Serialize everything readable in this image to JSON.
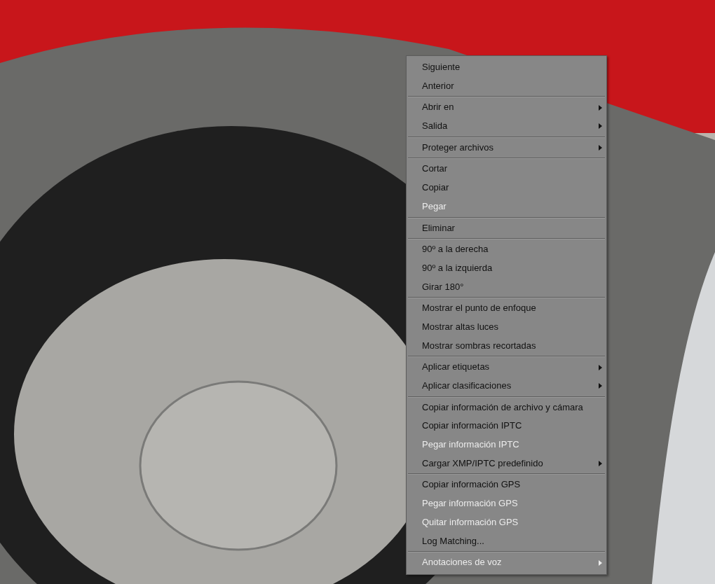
{
  "context_menu": {
    "items": [
      {
        "kind": "item",
        "label": "Siguiente",
        "disabled": false,
        "submenu": false
      },
      {
        "kind": "item",
        "label": "Anterior",
        "disabled": false,
        "submenu": false
      },
      {
        "kind": "separator"
      },
      {
        "kind": "item",
        "label": "Abrir en",
        "disabled": false,
        "submenu": true
      },
      {
        "kind": "item",
        "label": "Salida",
        "disabled": false,
        "submenu": true
      },
      {
        "kind": "separator"
      },
      {
        "kind": "item",
        "label": "Proteger archivos",
        "disabled": false,
        "submenu": true
      },
      {
        "kind": "separator"
      },
      {
        "kind": "item",
        "label": "Cortar",
        "disabled": false,
        "submenu": false
      },
      {
        "kind": "item",
        "label": "Copiar",
        "disabled": false,
        "submenu": false
      },
      {
        "kind": "item",
        "label": "Pegar",
        "disabled": true,
        "submenu": false
      },
      {
        "kind": "separator"
      },
      {
        "kind": "item",
        "label": "Eliminar",
        "disabled": false,
        "submenu": false
      },
      {
        "kind": "separator"
      },
      {
        "kind": "item",
        "label": "90º a la derecha",
        "disabled": false,
        "submenu": false
      },
      {
        "kind": "item",
        "label": "90º a la izquierda",
        "disabled": false,
        "submenu": false
      },
      {
        "kind": "item",
        "label": "Girar 180°",
        "disabled": false,
        "submenu": false
      },
      {
        "kind": "separator"
      },
      {
        "kind": "item",
        "label": "Mostrar el punto de enfoque",
        "disabled": false,
        "submenu": false
      },
      {
        "kind": "item",
        "label": "Mostrar altas luces",
        "disabled": false,
        "submenu": false
      },
      {
        "kind": "item",
        "label": "Mostrar sombras recortadas",
        "disabled": false,
        "submenu": false
      },
      {
        "kind": "separator"
      },
      {
        "kind": "item",
        "label": "Aplicar etiquetas",
        "disabled": false,
        "submenu": true
      },
      {
        "kind": "item",
        "label": "Aplicar clasificaciones",
        "disabled": false,
        "submenu": true
      },
      {
        "kind": "separator"
      },
      {
        "kind": "item",
        "label": "Copiar información de archivo y cámara",
        "disabled": false,
        "submenu": false
      },
      {
        "kind": "item",
        "label": "Copiar información IPTC",
        "disabled": false,
        "submenu": false
      },
      {
        "kind": "item",
        "label": "Pegar información IPTC",
        "disabled": true,
        "submenu": false
      },
      {
        "kind": "item",
        "label": "Cargar XMP/IPTC predefinido",
        "disabled": false,
        "submenu": true
      },
      {
        "kind": "separator"
      },
      {
        "kind": "item",
        "label": "Copiar información GPS",
        "disabled": false,
        "submenu": false
      },
      {
        "kind": "item",
        "label": "Pegar información GPS",
        "disabled": true,
        "submenu": false
      },
      {
        "kind": "item",
        "label": "Quitar información GPS",
        "disabled": true,
        "submenu": false
      },
      {
        "kind": "item",
        "label": "Log Matching...",
        "disabled": false,
        "submenu": false
      },
      {
        "kind": "separator"
      },
      {
        "kind": "item",
        "label": "Anotaciones de voz",
        "disabled": true,
        "submenu": true
      }
    ]
  }
}
